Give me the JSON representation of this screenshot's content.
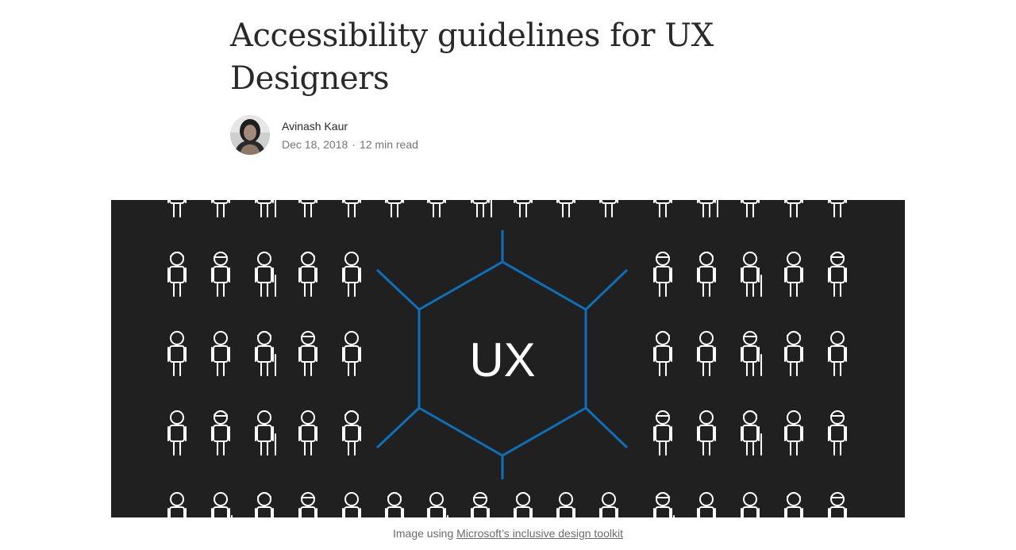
{
  "article": {
    "title": "Accessibility guidelines for UX Designers"
  },
  "author": {
    "name": "Avinash Kaur",
    "date": "Dec 18, 2018",
    "separator": "·",
    "read_time": "12 min read"
  },
  "hero": {
    "center_text": "UX",
    "background_color": "#202020",
    "hexagon_color": "#0e6fb8",
    "figure_color": "#ffffff"
  },
  "caption": {
    "prefix": "Image using ",
    "link_text": "Microsoft’s inclusive design toolkit"
  }
}
